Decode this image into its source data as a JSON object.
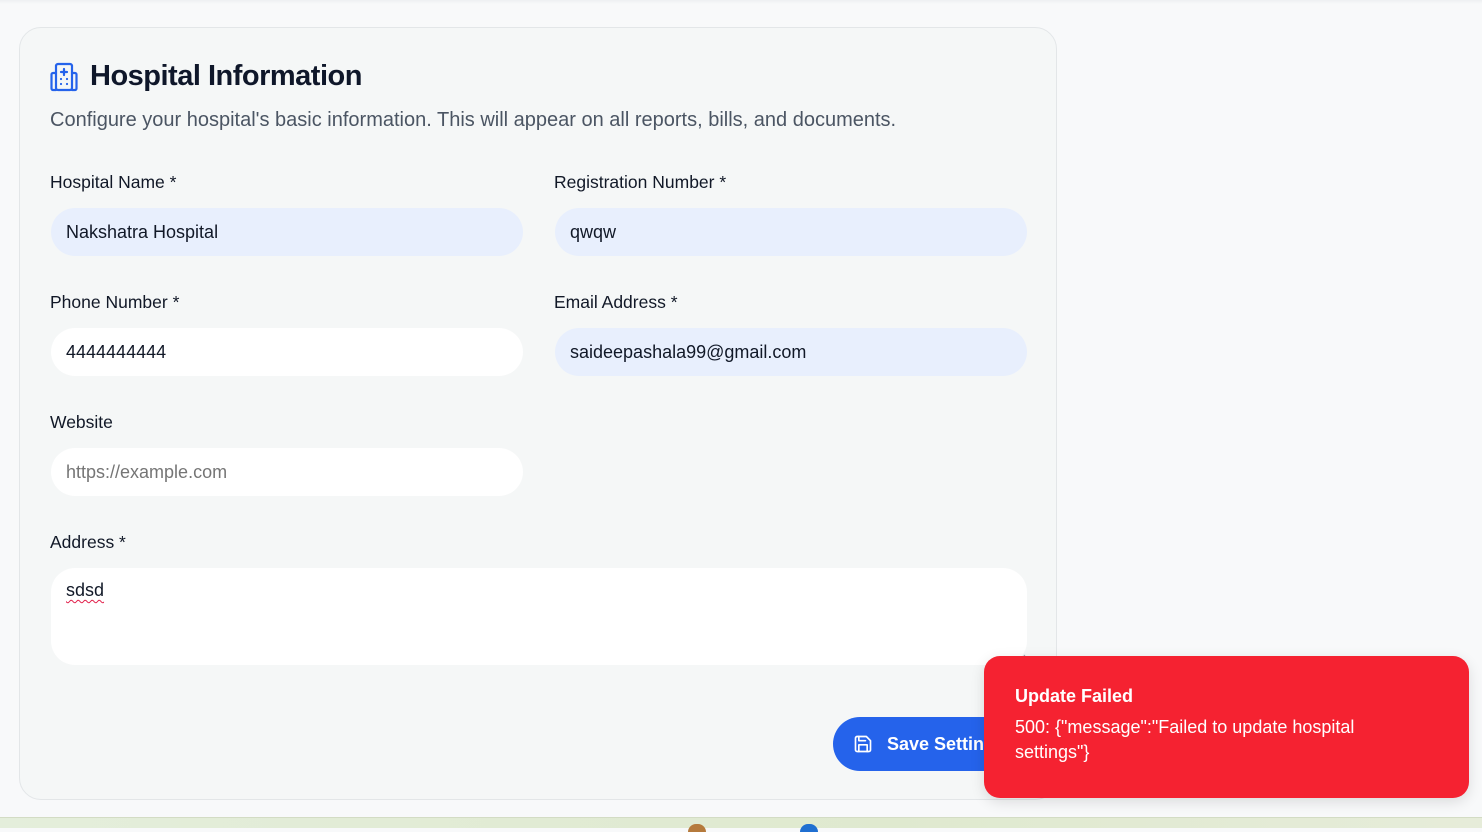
{
  "section": {
    "title": "Hospital Information",
    "description": "Configure your hospital's basic information. This will appear on all reports, bills, and documents."
  },
  "fields": {
    "hospital_name": {
      "label": "Hospital Name *",
      "value": "Nakshatra Hospital"
    },
    "registration_number": {
      "label": "Registration Number *",
      "value": "qwqw"
    },
    "phone_number": {
      "label": "Phone Number *",
      "value": "4444444444"
    },
    "email_address": {
      "label": "Email Address *",
      "value": "saideepashala99@gmail.com"
    },
    "website": {
      "label": "Website",
      "value": "",
      "placeholder": "https://example.com"
    },
    "address": {
      "label": "Address *",
      "value": "sdsd"
    }
  },
  "actions": {
    "save_label": "Save Settings"
  },
  "toast": {
    "title": "Update Failed",
    "message": "500: {\"message\":\"Failed to update hospital settings\"}"
  },
  "icons": {
    "section": "hospital-building-icon",
    "save": "floppy-disk-icon"
  },
  "colors": {
    "primary": "#2563eb",
    "error": "#f52231",
    "autofill": "#e8effd",
    "card_background": "#f5f7f7"
  }
}
